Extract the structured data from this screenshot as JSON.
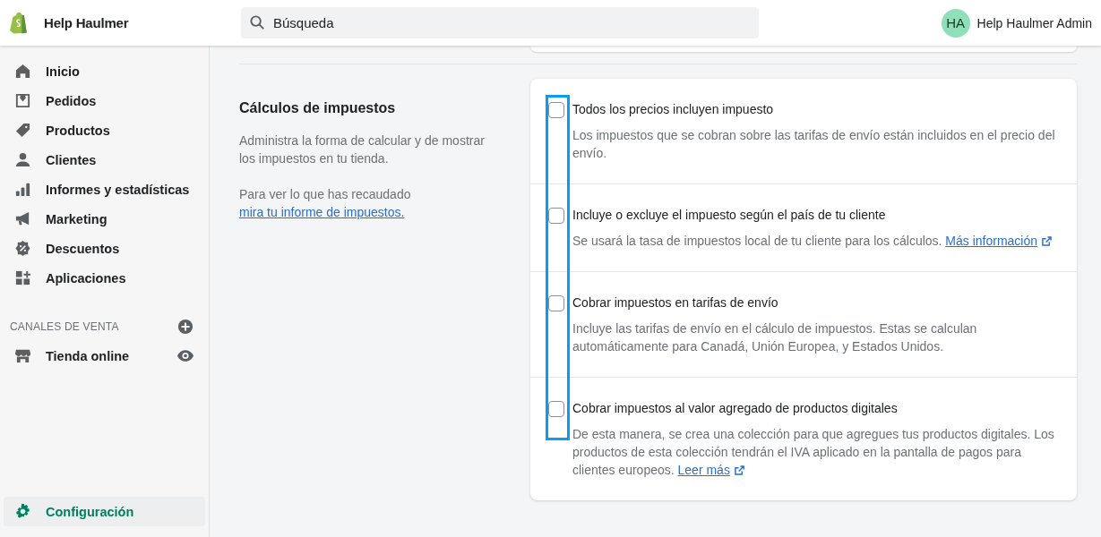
{
  "topbar": {
    "store_name": "Help Haulmer",
    "search": {
      "placeholder": "Búsqueda"
    },
    "user": {
      "initials": "HA",
      "name": "Help Haulmer Admin"
    }
  },
  "sidebar": {
    "items": [
      {
        "kind": "home",
        "label": "Inicio",
        "selected": false
      },
      {
        "kind": "orders",
        "label": "Pedidos",
        "selected": false
      },
      {
        "kind": "tag",
        "label": "Productos",
        "selected": false
      },
      {
        "kind": "person",
        "label": "Clientes",
        "selected": false
      },
      {
        "kind": "bars",
        "label": "Informes y estadísticas",
        "selected": false
      },
      {
        "kind": "megaphone",
        "label": "Marketing",
        "selected": false
      },
      {
        "kind": "discount",
        "label": "Descuentos",
        "selected": false
      },
      {
        "kind": "apps",
        "label": "Aplicaciones",
        "selected": false
      }
    ],
    "channels_heading": "CANALES DE VENTA",
    "channels": [
      {
        "kind": "store",
        "label": "Tienda online",
        "selected": false
      }
    ],
    "footer_item": {
      "kind": "gear",
      "label": "Configuración",
      "selected": true
    }
  },
  "section": {
    "title": "Cálculos de impuestos",
    "description": "Administra la forma de calcular y de mostrar los impuestos en tu tienda.",
    "note": {
      "text": "Para ver lo que has recaudado",
      "link": "mira tu informe de impuestos."
    }
  },
  "options": [
    {
      "label": "Todos los precios incluyen impuesto",
      "checked": false,
      "description": "Los impuestos que se cobran sobre las tarifas de envío están incluidos en el precio del envío."
    },
    {
      "label": "Incluye o excluye el impuesto según el país de tu cliente",
      "checked": false,
      "description": "Se usará la tasa de impuestos local de tu cliente para los cálculos.",
      "link": "Más información"
    },
    {
      "label": "Cobrar impuestos en tarifas de envío",
      "checked": false,
      "description": "Incluye las tarifas de envío en el cálculo de impuestos. Estas se calculan automáticamente para Canadá, Unión Europea, y Estados Unidos."
    },
    {
      "label": "Cobrar impuestos al valor agregado de productos digitales",
      "checked": false,
      "description": "De esta manera, se crea una colección para que agregues tus productos digitales. Los productos de esta colección tendrán el IVA aplicado en la pantalla de pagos para clientes europeos.",
      "link": "Leer más"
    }
  ],
  "checkbox_highlight": true
}
